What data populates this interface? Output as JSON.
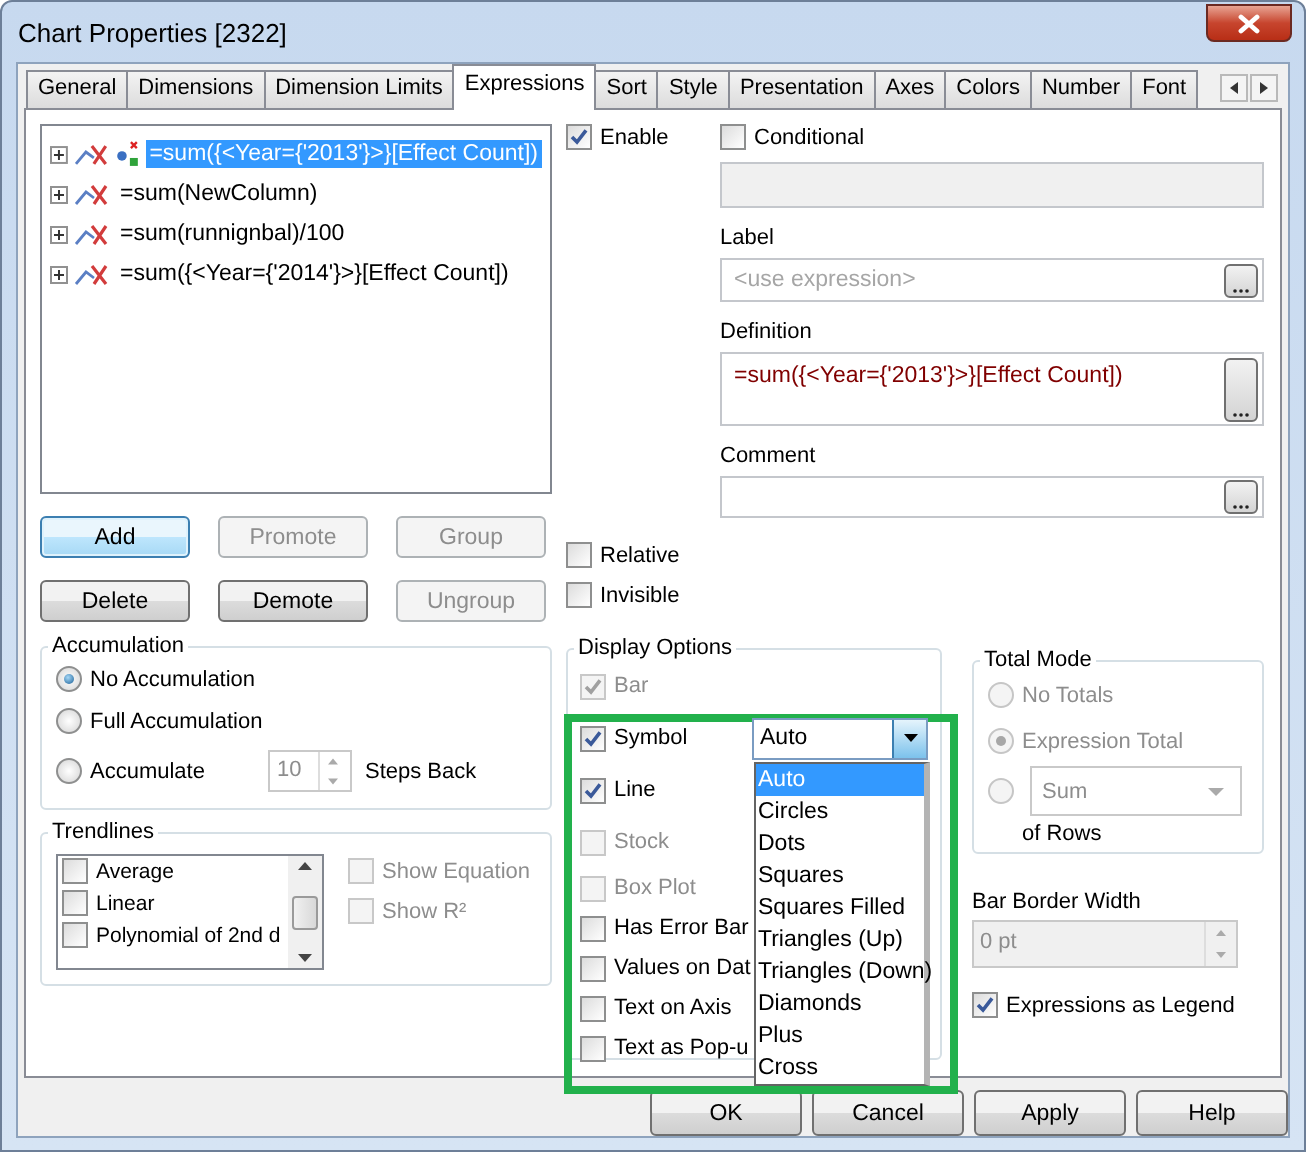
{
  "window": {
    "title": "Chart Properties [2322]"
  },
  "tabs": [
    {
      "label": "General",
      "selected": false
    },
    {
      "label": "Dimensions",
      "selected": false
    },
    {
      "label": "Dimension Limits",
      "selected": false
    },
    {
      "label": "Expressions",
      "selected": true
    },
    {
      "label": "Sort",
      "selected": false
    },
    {
      "label": "Style",
      "selected": false
    },
    {
      "label": "Presentation",
      "selected": false
    },
    {
      "label": "Axes",
      "selected": false
    },
    {
      "label": "Colors",
      "selected": false
    },
    {
      "label": "Number",
      "selected": false
    },
    {
      "label": "Font",
      "selected": false
    }
  ],
  "expressions": [
    {
      "text": "=sum({<Year={'2013'}>}[Effect Count])",
      "kind": "line_symbol",
      "selected": true
    },
    {
      "text": "=sum(NewColumn)",
      "kind": "line",
      "selected": false
    },
    {
      "text": "=sum(runnignbal)/100",
      "kind": "line",
      "selected": false
    },
    {
      "text": "=sum({<Year={'2014'}>}[Effect Count])",
      "kind": "line",
      "selected": false
    }
  ],
  "expression_buttons": [
    {
      "label": "Add",
      "disabled": false,
      "default": true
    },
    {
      "label": "Promote",
      "disabled": true,
      "default": false
    },
    {
      "label": "Group",
      "disabled": true,
      "default": false
    },
    {
      "label": "Delete",
      "disabled": false,
      "default": false
    },
    {
      "label": "Demote",
      "disabled": false,
      "default": false
    },
    {
      "label": "Ungroup",
      "disabled": true,
      "default": false
    }
  ],
  "enable": {
    "label": "Enable",
    "checked": true
  },
  "conditional": {
    "label": "Conditional",
    "checked": false
  },
  "label_field": {
    "label": "Label",
    "placeholder": "<use expression>"
  },
  "definition": {
    "label": "Definition",
    "value": "=sum({<Year={'2013'}>}[Effect Count])"
  },
  "comment": {
    "label": "Comment"
  },
  "relative": {
    "label": "Relative",
    "checked": false
  },
  "invisible": {
    "label": "Invisible",
    "checked": false
  },
  "accumulation": {
    "title": "Accumulation",
    "options": [
      {
        "label": "No Accumulation",
        "selected": true
      },
      {
        "label": "Full Accumulation",
        "selected": false
      },
      {
        "label": "Accumulate",
        "selected": false
      }
    ],
    "steps": "10",
    "steps_label": "Steps Back"
  },
  "trendlines": {
    "title": "Trendlines",
    "items": [
      {
        "label": "Average",
        "checked": false
      },
      {
        "label": "Linear",
        "checked": false
      },
      {
        "label": "Polynomial of 2nd d",
        "checked": false
      }
    ],
    "show_equation": {
      "label": "Show Equation",
      "checked": false,
      "disabled": true
    },
    "show_r2": {
      "label": "Show R²",
      "checked": false,
      "disabled": true
    }
  },
  "display_options": {
    "title": "Display Options",
    "items": [
      {
        "label": "Bar",
        "checked": true,
        "disabled": true
      },
      {
        "label": "Symbol",
        "checked": true,
        "disabled": false
      },
      {
        "label": "Line",
        "checked": true,
        "disabled": false
      },
      {
        "label": "Stock",
        "checked": false,
        "disabled": true
      },
      {
        "label": "Box Plot",
        "checked": false,
        "disabled": true
      },
      {
        "label": "Has Error Bar",
        "checked": false,
        "disabled": false
      },
      {
        "label": "Values on Dat",
        "checked": false,
        "disabled": false
      },
      {
        "label": "Text on Axis",
        "checked": false,
        "disabled": false
      },
      {
        "label": "Text as Pop-u",
        "checked": false,
        "disabled": false
      }
    ],
    "symbol_combo": {
      "value": "Auto",
      "expanded": true,
      "options": [
        {
          "label": "Auto",
          "selected": true
        },
        {
          "label": "Circles",
          "selected": false
        },
        {
          "label": "Dots",
          "selected": false
        },
        {
          "label": "Squares",
          "selected": false
        },
        {
          "label": "Squares Filled",
          "selected": false
        },
        {
          "label": "Triangles (Up)",
          "selected": false
        },
        {
          "label": "Triangles (Down)",
          "selected": false
        },
        {
          "label": "Diamonds",
          "selected": false
        },
        {
          "label": "Plus",
          "selected": false
        },
        {
          "label": "Cross",
          "selected": false
        }
      ]
    }
  },
  "total_mode": {
    "title": "Total Mode",
    "disabled": true,
    "options": [
      {
        "kind": "radio",
        "label": "No Totals",
        "selected": false
      },
      {
        "kind": "radio",
        "label": "Expression Total",
        "selected": true
      },
      {
        "kind": "combo",
        "value": "Sum",
        "selected": false
      }
    ],
    "of_rows": "of Rows"
  },
  "bar_border_width": {
    "label": "Bar Border Width",
    "value": "0 pt",
    "disabled": true
  },
  "expressions_as_legend": {
    "label": "Expressions as Legend",
    "checked": true
  },
  "footer_buttons": [
    {
      "label": "OK"
    },
    {
      "label": "Cancel"
    },
    {
      "label": "Apply"
    },
    {
      "label": "Help"
    }
  ]
}
